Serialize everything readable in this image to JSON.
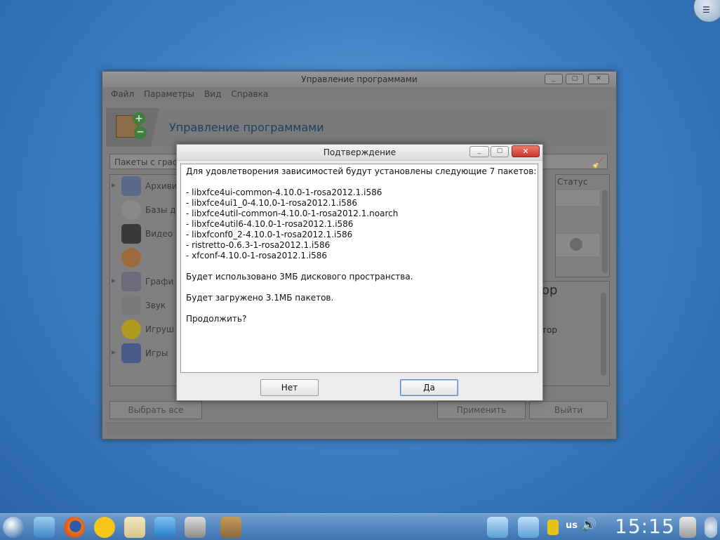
{
  "desktop": {
    "corner_icon": "☰"
  },
  "main_window": {
    "title": "Управление программами",
    "controls": [
      "_",
      "▢",
      "✕"
    ],
    "menu": [
      "Файл",
      "Параметры",
      "Вид",
      "Справка"
    ],
    "banner_title": "Управление программами",
    "search_value": "Пакеты с граф",
    "categories": [
      {
        "label": "Архиви",
        "icon": "archive-icon",
        "expander": "▶",
        "color": "#5a6a8a"
      },
      {
        "label": "Базы да",
        "icon": "database-icon",
        "expander": "",
        "color": "#8a8a8a"
      },
      {
        "label": "Видео",
        "icon": "video-icon",
        "expander": "",
        "color": "#3a3a3a"
      },
      {
        "label": "",
        "icon": "palette-icon",
        "expander": "",
        "color": "#9a6a3a"
      },
      {
        "label": "Графи",
        "icon": "graphics-icon",
        "expander": "▶",
        "color": "#6a6a7a"
      },
      {
        "label": "Звук",
        "icon": "sound-icon",
        "expander": "",
        "color": "#7a7a7a"
      },
      {
        "label": "Игруш",
        "icon": "smiley-icon",
        "expander": "",
        "color": "#b09a20"
      },
      {
        "label": "Игры",
        "icon": "gamepad-icon",
        "expander": "▶",
        "color": "#4a5a8a"
      }
    ],
    "list_header_status": "Статус",
    "description_title": "ор",
    "description_text": "тор",
    "buttons": {
      "select_all": "Выбрать все",
      "apply": "Применить",
      "exit": "Выйти"
    }
  },
  "dialog": {
    "title": "Подтверждение",
    "lines": [
      "Для удовлетворения зависимостей будут установлены следующие 7 пакетов:",
      "",
      "- libxfce4ui-common-4.10.0-1-rosa2012.1.i586",
      "- libxfce4ui1_0-4.10.0-1-rosa2012.1.i586",
      "- libxfce4util-common-4.10.0-1-rosa2012.1.noarch",
      "- libxfce4util6-4.10.0-1-rosa2012.1.i586",
      "- libxfconf0_2-4.10.0-1-rosa2012.1.i586",
      "- ristretto-0.6.3-1-rosa2012.1.i586",
      "- xfconf-4.10.0-1-rosa2012.1.i586",
      "",
      "Будет использовано 3МБ дискового пространства.",
      "",
      "Будет загружено 3.1МБ пакетов.",
      "",
      "Продолжить?"
    ],
    "no_label": "Нет",
    "yes_label": "Да",
    "close_icon": "✕"
  },
  "taskbar": {
    "keyboard_layout": "us",
    "volume_icon": "🔊",
    "clock": "15:15"
  }
}
